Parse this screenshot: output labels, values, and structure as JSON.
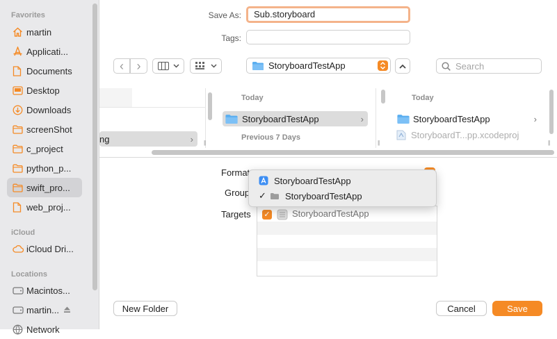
{
  "sidebar": {
    "favorites_header": "Favorites",
    "favorites": [
      {
        "label": "martin",
        "icon": "home-icon"
      },
      {
        "label": "Applicati...",
        "icon": "applications-icon"
      },
      {
        "label": "Documents",
        "icon": "document-icon"
      },
      {
        "label": "Desktop",
        "icon": "desktop-icon"
      },
      {
        "label": "Downloads",
        "icon": "downloads-icon"
      },
      {
        "label": "screenShot",
        "icon": "folder-icon"
      },
      {
        "label": "c_project",
        "icon": "folder-icon"
      },
      {
        "label": "python_p...",
        "icon": "folder-icon"
      },
      {
        "label": "swift_pro...",
        "icon": "folder-icon",
        "selected": true
      },
      {
        "label": "web_proj...",
        "icon": "document-icon"
      }
    ],
    "icloud_header": "iCloud",
    "icloud": [
      {
        "label": "iCloud Dri...",
        "icon": "cloud-icon"
      }
    ],
    "locations_header": "Locations",
    "locations": [
      {
        "label": "Macintos...",
        "icon": "disk-icon"
      },
      {
        "label": "martin...",
        "icon": "disk-icon",
        "eject": true
      },
      {
        "label": "Network",
        "icon": "network-icon"
      }
    ]
  },
  "header": {
    "save_as_label": "Save As:",
    "save_as_value": "Sub.storyboard",
    "tags_label": "Tags:",
    "tags_value": ""
  },
  "toolbar": {
    "back": "‹",
    "forward": "›",
    "location": "StoryboardTestApp",
    "search_placeholder": "Search"
  },
  "browser": {
    "col1_selected": "ng",
    "col2": {
      "today_header": "Today",
      "item": "StoryboardTestApp",
      "prev_header": "Previous 7 Days"
    },
    "col3": {
      "today_header": "Today",
      "item": "StoryboardTestApp",
      "item2": "StoryboardT...pp.xcodeproj"
    }
  },
  "options": {
    "format_label": "Format",
    "group_label": "Group",
    "targets_label": "Targets",
    "target_item": "StoryboardTestApp"
  },
  "group_menu": {
    "items": [
      {
        "label": "StoryboardTestApp",
        "checked": false,
        "icon": "app-icon"
      },
      {
        "label": "StoryboardTestApp",
        "checked": true,
        "icon": "folder-icon"
      }
    ]
  },
  "footer": {
    "new_folder": "New Folder",
    "cancel": "Cancel",
    "save": "Save"
  },
  "colors": {
    "accent": "#f58a25",
    "sidebar_bg": "#e9e9eb",
    "folder": "#5aaef0"
  }
}
